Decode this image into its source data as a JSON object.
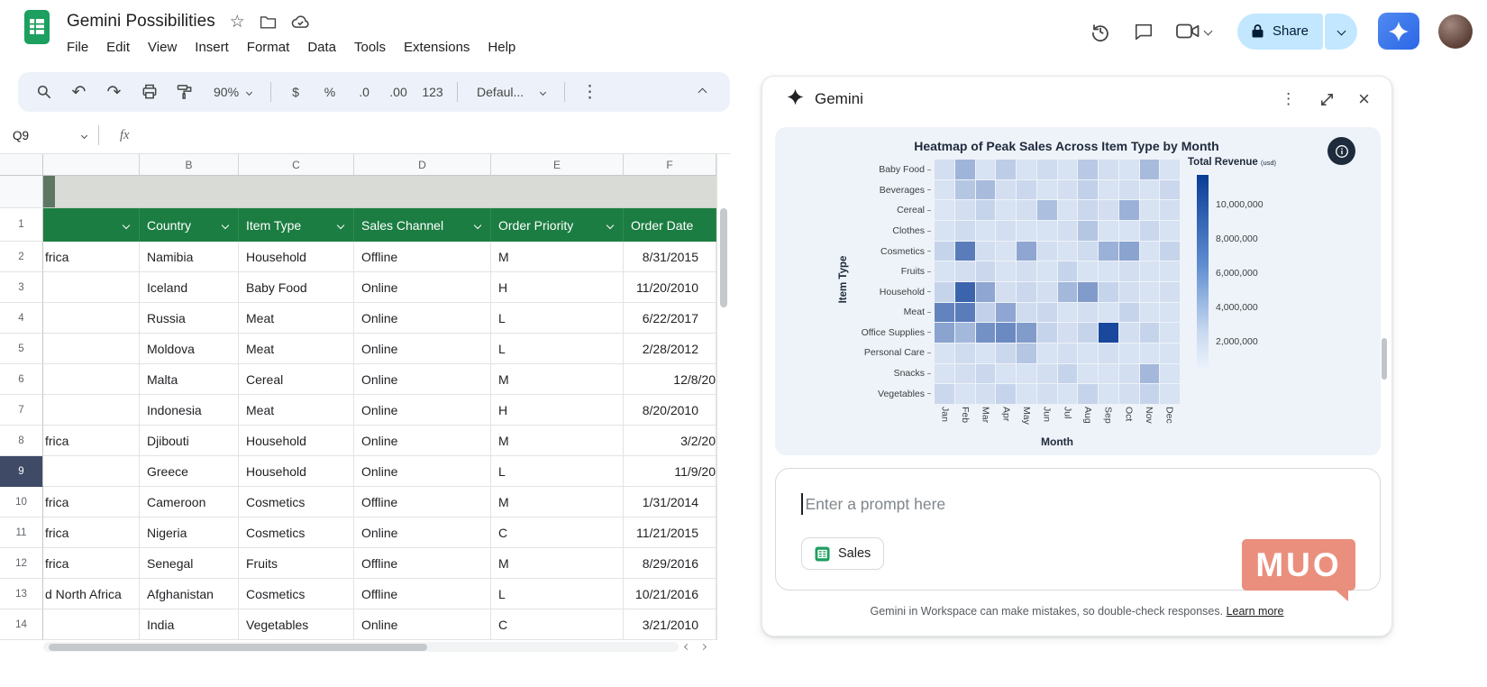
{
  "topbar": {
    "doc_title": "Gemini Possibilities",
    "menus": [
      "File",
      "Edit",
      "View",
      "Insert",
      "Format",
      "Data",
      "Tools",
      "Extensions",
      "Help"
    ],
    "share_label": "Share"
  },
  "icons": {
    "star": "☆",
    "undo": "↶",
    "redo": "↷",
    "kebab": "⋮",
    "close": "×"
  },
  "toolbar": {
    "zoom": "90%",
    "currency": "$",
    "percent": "%",
    "decrease_decimal": ".0",
    "increase_decimal": ".00",
    "more_formats": "123",
    "font": "Defaul..."
  },
  "formula_bar": {
    "cell_ref": "Q9",
    "fx": "fx"
  },
  "grid": {
    "col_letters_row": [
      "",
      "B",
      "C",
      "D",
      "E",
      "F"
    ],
    "header": [
      {
        "label": "",
        "chev": true
      },
      {
        "label": "Country",
        "chev": true
      },
      {
        "label": "Item Type",
        "chev": true
      },
      {
        "label": "Sales Channel",
        "chev": true
      },
      {
        "label": "Order Priority",
        "chev": true
      },
      {
        "label": "Order Date",
        "chev": false
      }
    ],
    "selected_row": 9,
    "rows": [
      {
        "n": 2,
        "a": "frica",
        "b": "Namibia",
        "c": "Household",
        "d": "Offline",
        "e": "M",
        "f": "8/31/2015",
        "clip": false
      },
      {
        "n": 3,
        "a": "",
        "b": "Iceland",
        "c": "Baby Food",
        "d": "Online",
        "e": "H",
        "f": "11/20/2010",
        "clip": false
      },
      {
        "n": 4,
        "a": "",
        "b": "Russia",
        "c": "Meat",
        "d": "Online",
        "e": "L",
        "f": "6/22/2017",
        "clip": false
      },
      {
        "n": 5,
        "a": "",
        "b": "Moldova",
        "c": "Meat",
        "d": "Online",
        "e": "L",
        "f": "2/28/2012",
        "clip": false
      },
      {
        "n": 6,
        "a": "",
        "b": "Malta",
        "c": "Cereal",
        "d": "Online",
        "e": "M",
        "f": "12/8/20",
        "clip": true
      },
      {
        "n": 7,
        "a": "",
        "b": "Indonesia",
        "c": "Meat",
        "d": "Online",
        "e": "H",
        "f": "8/20/2010",
        "clip": false
      },
      {
        "n": 8,
        "a": "frica",
        "b": "Djibouti",
        "c": "Household",
        "d": "Online",
        "e": "M",
        "f": "3/2/20",
        "clip": true
      },
      {
        "n": 9,
        "a": "",
        "b": "Greece",
        "c": "Household",
        "d": "Online",
        "e": "L",
        "f": "11/9/20",
        "clip": true
      },
      {
        "n": 10,
        "a": "frica",
        "b": "Cameroon",
        "c": "Cosmetics",
        "d": "Offline",
        "e": "M",
        "f": "1/31/2014",
        "clip": false
      },
      {
        "n": 11,
        "a": "frica",
        "b": "Nigeria",
        "c": "Cosmetics",
        "d": "Online",
        "e": "C",
        "f": "11/21/2015",
        "clip": false
      },
      {
        "n": 12,
        "a": "frica",
        "b": "Senegal",
        "c": "Fruits",
        "d": "Offline",
        "e": "M",
        "f": "8/29/2016",
        "clip": false
      },
      {
        "n": 13,
        "a": "d North Africa",
        "b": "Afghanistan",
        "c": "Cosmetics",
        "d": "Offline",
        "e": "L",
        "f": "10/21/2016",
        "clip": false
      },
      {
        "n": 14,
        "a": "",
        "b": "India",
        "c": "Vegetables",
        "d": "Online",
        "e": "C",
        "f": "3/21/2010",
        "clip": false
      }
    ]
  },
  "gemini": {
    "title": "Gemini",
    "prompt_placeholder": "Enter a prompt here",
    "chip_label": "Sales",
    "disclaimer": "Gemini in Workspace can make mistakes, so double-check responses.",
    "learn_more": "Learn more"
  },
  "watermark": "MUO",
  "chart_data": {
    "type": "heatmap",
    "title": "Heatmap of Peak Sales Across Item Type by Month",
    "xlabel": "Month",
    "ylabel": "Item Type",
    "legend_title": "Total Revenue",
    "legend_sub": "(usd)",
    "x": [
      "Jan",
      "Feb",
      "Mar",
      "Apr",
      "May",
      "Jun",
      "Jul",
      "Aug",
      "Sep",
      "Oct",
      "Nov",
      "Dec"
    ],
    "y": [
      "Baby Food",
      "Beverages",
      "Cereal",
      "Clothes",
      "Cosmetics",
      "Fruits",
      "Household",
      "Meat",
      "Office Supplies",
      "Personal Care",
      "Snacks",
      "Vegetables"
    ],
    "colorbar_ticks": [
      "10,000,000",
      "8,000,000",
      "6,000,000",
      "4,000,000",
      "2,000,000"
    ],
    "color_low": "#edf3fc",
    "color_high": "#0a3c96",
    "scale_max": 10500000,
    "values": [
      [
        1200000,
        3600000,
        1000000,
        2200000,
        1000000,
        1400000,
        1000000,
        2400000,
        1200000,
        1000000,
        3200000,
        1000000
      ],
      [
        1000000,
        2600000,
        3200000,
        1200000,
        1600000,
        1000000,
        1200000,
        2000000,
        1000000,
        1200000,
        1000000,
        1600000
      ],
      [
        800000,
        1200000,
        1800000,
        1000000,
        1200000,
        3000000,
        1000000,
        1600000,
        1200000,
        3800000,
        1000000,
        1200000
      ],
      [
        1000000,
        1400000,
        1000000,
        1200000,
        1000000,
        1000000,
        1200000,
        2600000,
        1000000,
        1000000,
        1600000,
        1000000
      ],
      [
        1800000,
        6800000,
        1200000,
        1000000,
        4400000,
        1200000,
        1000000,
        1400000,
        3800000,
        4600000,
        1000000,
        1800000
      ],
      [
        1000000,
        1200000,
        1600000,
        1000000,
        1200000,
        1000000,
        1800000,
        1000000,
        1000000,
        1200000,
        1000000,
        1000000
      ],
      [
        1800000,
        8200000,
        4400000,
        1200000,
        1600000,
        1200000,
        3400000,
        5000000,
        1800000,
        1200000,
        1000000,
        1200000
      ],
      [
        6400000,
        6800000,
        2000000,
        4400000,
        1400000,
        1600000,
        1000000,
        1200000,
        1000000,
        1800000,
        1000000,
        1000000
      ],
      [
        4600000,
        3400000,
        5600000,
        6000000,
        5000000,
        1800000,
        1200000,
        1800000,
        9800000,
        1200000,
        1800000,
        1000000
      ],
      [
        1000000,
        1400000,
        1000000,
        1600000,
        2600000,
        1000000,
        1200000,
        1000000,
        1200000,
        1000000,
        1000000,
        1000000
      ],
      [
        1000000,
        1200000,
        1600000,
        1000000,
        1000000,
        1200000,
        1800000,
        1000000,
        1000000,
        1200000,
        3400000,
        1000000
      ],
      [
        1600000,
        1000000,
        1200000,
        1800000,
        1000000,
        1200000,
        1000000,
        1800000,
        1000000,
        1200000,
        1800000,
        1000000
      ]
    ]
  }
}
